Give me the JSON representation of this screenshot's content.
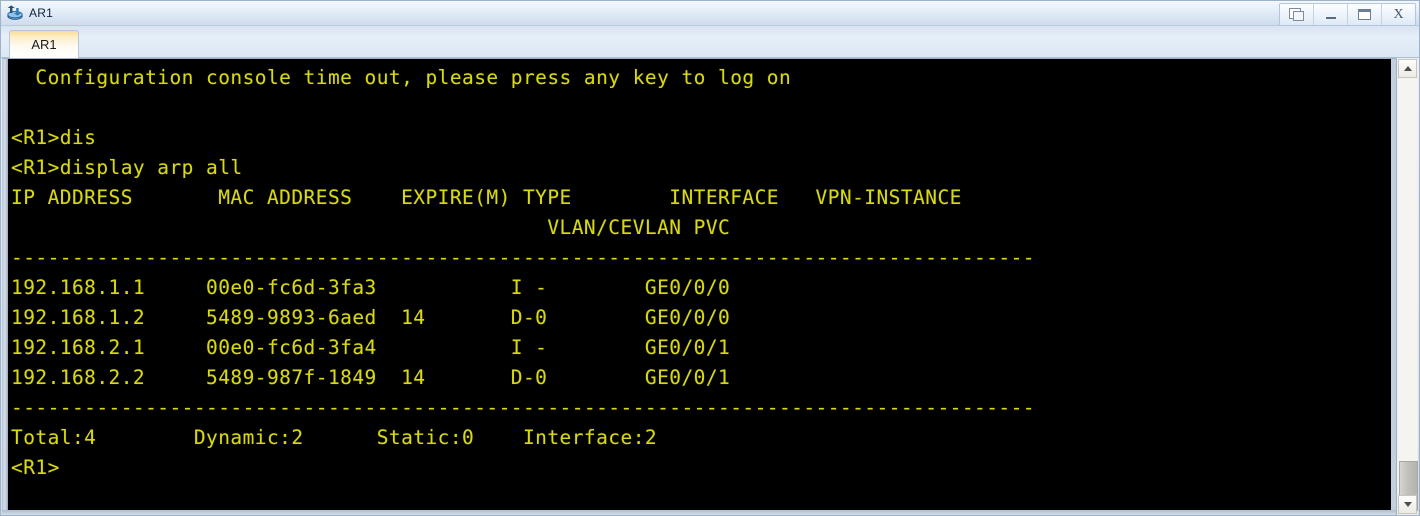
{
  "window": {
    "title": "AR1",
    "icon": "router-icon",
    "controls": [
      {
        "name": "restore-button",
        "icon": "restore-icon",
        "label": ""
      },
      {
        "name": "minimize-button",
        "icon": "minimize-icon",
        "label": ""
      },
      {
        "name": "maximize-button",
        "icon": "maximize-icon",
        "label": ""
      },
      {
        "name": "close-button",
        "icon": "close-icon",
        "label": "X"
      }
    ]
  },
  "tabs": [
    {
      "label": "AR1",
      "active": true
    }
  ],
  "terminal": {
    "foreground_color": "#d8d814",
    "background_color": "#000000",
    "banner": "  Configuration console time out, please press any key to log on",
    "blank": "",
    "prompt_1": "<R1>dis",
    "prompt_2": "<R1>display arp all",
    "header_line_1": "IP ADDRESS       MAC ADDRESS    EXPIRE(M) TYPE        INTERFACE   VPN-INSTANCE",
    "header_line_2": "                                            VLAN/CEVLAN PVC",
    "divider_top": "------------------------------------------------------------------------------------",
    "rows": [
      "192.168.1.1     00e0-fc6d-3fa3           I -        GE0/0/0",
      "192.168.1.2     5489-9893-6aed  14       D-0        GE0/0/0",
      "192.168.2.1     00e0-fc6d-3fa4           I -        GE0/0/1",
      "192.168.2.2     5489-987f-1849  14       D-0        GE0/0/1"
    ],
    "divider_bottom": "------------------------------------------------------------------------------------",
    "summary": "Total:4        Dynamic:2      Static:0    Interface:2",
    "prompt_last": "<R1>"
  },
  "arp_table": {
    "columns": [
      "IP ADDRESS",
      "MAC ADDRESS",
      "EXPIRE(M)",
      "TYPE",
      "INTERFACE",
      "VPN-INSTANCE",
      "VLAN/CEVLAN",
      "PVC"
    ],
    "entries": [
      {
        "ip": "192.168.1.1",
        "mac": "00e0-fc6d-3fa3",
        "expire": "",
        "type": "I -",
        "interface": "GE0/0/0",
        "vpn_instance": ""
      },
      {
        "ip": "192.168.1.2",
        "mac": "5489-9893-6aed",
        "expire": "14",
        "type": "D-0",
        "interface": "GE0/0/0",
        "vpn_instance": ""
      },
      {
        "ip": "192.168.2.1",
        "mac": "00e0-fc6d-3fa4",
        "expire": "",
        "type": "I -",
        "interface": "GE0/0/1",
        "vpn_instance": ""
      },
      {
        "ip": "192.168.2.2",
        "mac": "5489-987f-1849",
        "expire": "14",
        "type": "D-0",
        "interface": "GE0/0/1",
        "vpn_instance": ""
      }
    ],
    "totals": {
      "total": "4",
      "dynamic": "2",
      "static": "0",
      "interface": "2"
    }
  },
  "scrollbar": {
    "up_arrow": "up-arrow-icon",
    "down_arrow": "down-arrow-icon"
  }
}
